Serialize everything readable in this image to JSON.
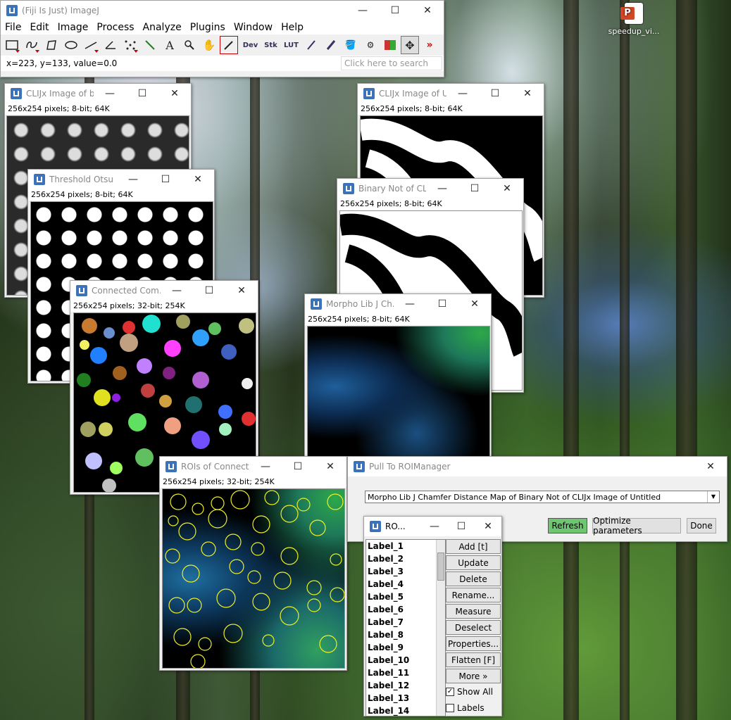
{
  "desktop": {
    "icon_label": "speedup_vi...",
    "icon": "powerpoint-file-icon"
  },
  "imagej": {
    "title": "(Fiji Is Just) ImageJ",
    "menu": [
      "File",
      "Edit",
      "Image",
      "Process",
      "Analyze",
      "Plugins",
      "Window",
      "Help"
    ],
    "tools": [
      "rectangle-tool-icon",
      "freehand-tool-icon",
      "polygon-tool-icon",
      "oval-tool-icon",
      "line-tool-icon",
      "angle-tool-icon",
      "multipoint-tool-icon",
      "wand-tool-icon",
      "text-tool-icon",
      "magnifier-tool-icon",
      "hand-tool-icon",
      "color-picker-tool-icon"
    ],
    "text_tools": [
      "Dev",
      "Stk",
      "LUT"
    ],
    "status": "x=223, y=133, value=0.0",
    "search_placeholder": "Click here to search"
  },
  "windows": {
    "clijx_b": {
      "title": "CLIJx Image of b...",
      "info": "256x254 pixels; 8-bit; 64K"
    },
    "threshold": {
      "title": "Threshold Otsu ...",
      "info": "256x254 pixels; 8-bit; 64K"
    },
    "connected": {
      "title": "Connected Com...",
      "info": "256x254 pixels; 32-bit; 254K"
    },
    "clijx_u": {
      "title": "CLIJx Image of U...",
      "info": "256x254 pixels; 8-bit; 64K"
    },
    "binarynot": {
      "title": "Binary Not of CL...",
      "info": "256x254 pixels; 8-bit; 64K"
    },
    "morpho": {
      "title": "Morpho Lib J Ch...",
      "info": "256x254 pixels; 8-bit; 64K"
    },
    "rois": {
      "title": "ROIs of Connect...",
      "info": "256x254 pixels; 32-bit; 254K"
    }
  },
  "dialog": {
    "title": "Pull To ROIManager",
    "selected": "Morpho Lib J Chamfer Distance Map of Binary Not of CLIJx Image of Untitled",
    "refresh": "Refresh",
    "optimize": "Optimize parameters",
    "done": "Done"
  },
  "roi_manager": {
    "title": "RO...",
    "labels": [
      "Label_1",
      "Label_2",
      "Label_3",
      "Label_4",
      "Label_5",
      "Label_6",
      "Label_7",
      "Label_8",
      "Label_9",
      "Label_10",
      "Label_11",
      "Label_12",
      "Label_13",
      "Label_14"
    ],
    "buttons": {
      "add": "Add [t]",
      "update": "Update",
      "delete": "Delete",
      "rename": "Rename...",
      "measure": "Measure",
      "deselect": "Deselect",
      "properties": "Properties...",
      "flatten": "Flatten [F]",
      "more": "More »"
    },
    "show_all": "Show All",
    "labels_check": "Labels"
  },
  "window_controls": {
    "minimize": "—",
    "maximize": "☐",
    "close": "✕"
  }
}
